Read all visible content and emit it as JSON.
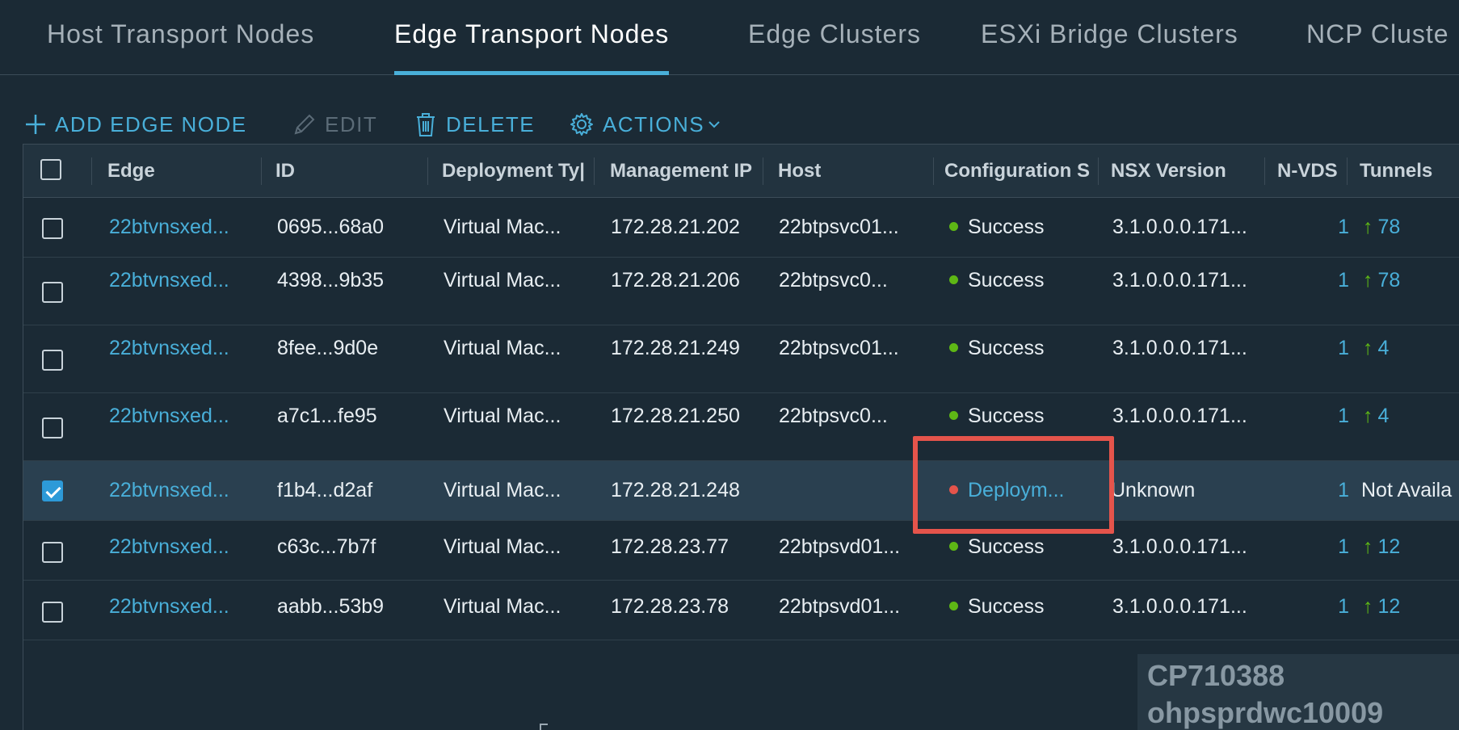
{
  "tabs": [
    {
      "label": "Host Transport Nodes",
      "active": false
    },
    {
      "label": "Edge Transport Nodes",
      "active": true
    },
    {
      "label": "Edge Clusters",
      "active": false
    },
    {
      "label": "ESXi Bridge Clusters",
      "active": false
    },
    {
      "label": "NCP Cluste",
      "active": false
    }
  ],
  "toolbar": {
    "add_label": "ADD EDGE NODE",
    "edit_label": "EDIT",
    "delete_label": "DELETE",
    "actions_label": "ACTIONS"
  },
  "columns": {
    "edge": "Edge",
    "id": "ID",
    "deployment_type": "Deployment Ty|",
    "management_ip": "Management IP",
    "host": "Host",
    "configuration_state": "Configuration S",
    "nsx_version": "NSX Version",
    "nvds": "N-VDS",
    "tunnels": "Tunnels"
  },
  "rows": [
    {
      "edge": "22btvnsxed...",
      "id": "0695...68a0",
      "deployment_type": "Virtual Mac...",
      "management_ip": "172.28.21.202",
      "host": "22btpsvc01...",
      "status": "Success",
      "nsx_version": "3.1.0.0.0.171...",
      "nvds": "1",
      "tunnels": "78",
      "selected": false
    },
    {
      "edge": "22btvnsxed...",
      "id": "4398...9b35",
      "deployment_type": "Virtual Mac...",
      "management_ip": "172.28.21.206",
      "host": "22btpsvc0...",
      "status": "Success",
      "nsx_version": "3.1.0.0.0.171...",
      "nvds": "1",
      "tunnels": "78",
      "selected": false
    },
    {
      "edge": "22btvnsxed...",
      "id": "8fee...9d0e",
      "deployment_type": "Virtual Mac...",
      "management_ip": "172.28.21.249",
      "host": "22btpsvc01...",
      "status": "Success",
      "nsx_version": "3.1.0.0.0.171...",
      "nvds": "1",
      "tunnels": "4",
      "selected": false
    },
    {
      "edge": "22btvnsxed...",
      "id": "a7c1...fe95",
      "deployment_type": "Virtual Mac...",
      "management_ip": "172.28.21.250",
      "host": "22btpsvc0...",
      "status": "Success",
      "nsx_version": "3.1.0.0.0.171...",
      "nvds": "1",
      "tunnels": "4",
      "selected": false
    },
    {
      "edge": "22btvnsxed...",
      "id": "f1b4...d2af",
      "deployment_type": "Virtual Mac...",
      "management_ip": "172.28.21.248",
      "host": "",
      "status": "Deploym...",
      "nsx_version": "Unknown",
      "nvds": "1",
      "tunnels": "Not Availa",
      "selected": true
    },
    {
      "edge": "22btvnsxed...",
      "id": "c63c...7b7f",
      "deployment_type": "Virtual Mac...",
      "management_ip": "172.28.23.77",
      "host": "22btpsvd01...",
      "status": "Success",
      "nsx_version": "3.1.0.0.0.171...",
      "nvds": "1",
      "tunnels": "12",
      "selected": false
    },
    {
      "edge": "22btvnsxed...",
      "id": "aabb...53b9",
      "deployment_type": "Virtual Mac...",
      "management_ip": "172.28.23.78",
      "host": "22btpsvd01...",
      "status": "Success",
      "nsx_version": "3.1.0.0.0.171...",
      "nvds": "1",
      "tunnels": "12",
      "selected": false
    }
  ],
  "watermark": {
    "line1": "CP710388",
    "line2": "ohpsprdwc10009"
  },
  "colors": {
    "accent": "#49afd9",
    "success": "#5eb715",
    "error": "#e5544b",
    "background": "#1b2a35"
  }
}
